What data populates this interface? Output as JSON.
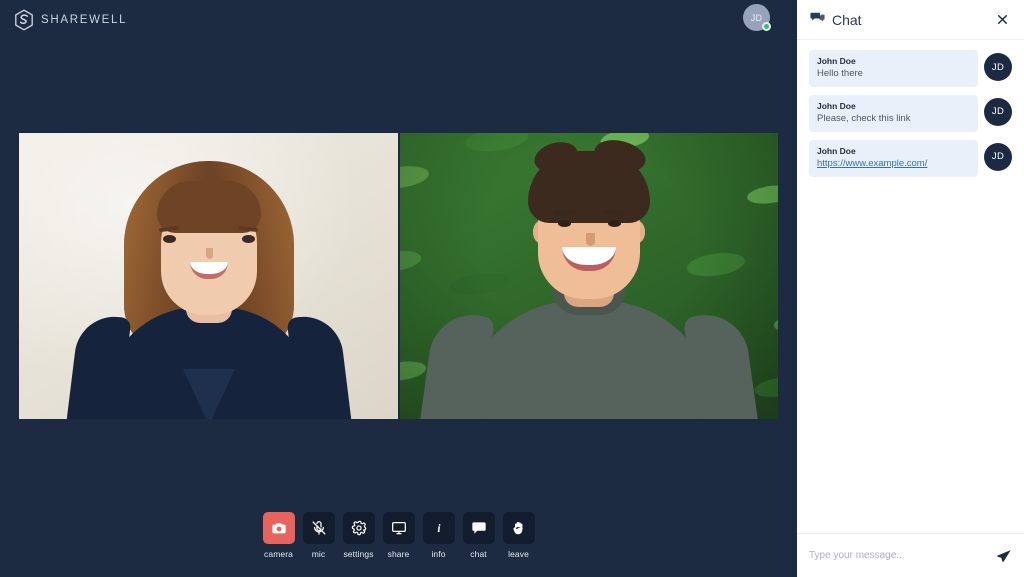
{
  "brand": {
    "name": "SHAREWELL",
    "logo_icon": "sharewell-hex-logo"
  },
  "top_bar": {
    "avatar_initials": "JD",
    "status": "online",
    "status_color": "#2fc26e"
  },
  "stage": {
    "background_color": "#1d2b42",
    "participants": [
      {
        "name": "participant-1",
        "description": "woman smiling, cream backdrop"
      },
      {
        "name": "participant-2",
        "description": "man smiling, green foliage backdrop"
      }
    ]
  },
  "controls": {
    "accent_active_color": "#e8635c",
    "button_bg_color": "#141d2e",
    "items": [
      {
        "label": "camera",
        "icon": "camera-icon",
        "active": true,
        "muted": false
      },
      {
        "label": "mic",
        "icon": "mic-off-icon",
        "active": false,
        "muted": true
      },
      {
        "label": "settings",
        "icon": "gear-icon",
        "active": false,
        "muted": false
      },
      {
        "label": "share",
        "icon": "monitor-icon",
        "active": false,
        "muted": false
      },
      {
        "label": "info",
        "icon": "info-icon",
        "active": false,
        "muted": false
      },
      {
        "label": "chat",
        "icon": "chat-bubble-icon",
        "active": false,
        "muted": false
      },
      {
        "label": "leave",
        "icon": "raised-hand-icon",
        "active": false,
        "muted": false
      }
    ]
  },
  "chat": {
    "title": "Chat",
    "title_icon": "chat-bubble-icon",
    "close_icon": "close-icon",
    "bubble_color": "#eaf0fa",
    "avatar_color": "#1b2943",
    "link_color": "#2f6fd0",
    "messages": [
      {
        "author": "John Doe",
        "text": "Hello there",
        "is_link": false,
        "avatar_initials": "JD"
      },
      {
        "author": "John Doe",
        "text": "Please, check this link",
        "is_link": false,
        "avatar_initials": "JD"
      },
      {
        "author": "John Doe",
        "text": "https://www.example.com/",
        "is_link": true,
        "avatar_initials": "JD"
      }
    ],
    "input": {
      "placeholder": "Type your message..",
      "value": "",
      "send_icon": "send-paper-plane-icon"
    }
  }
}
